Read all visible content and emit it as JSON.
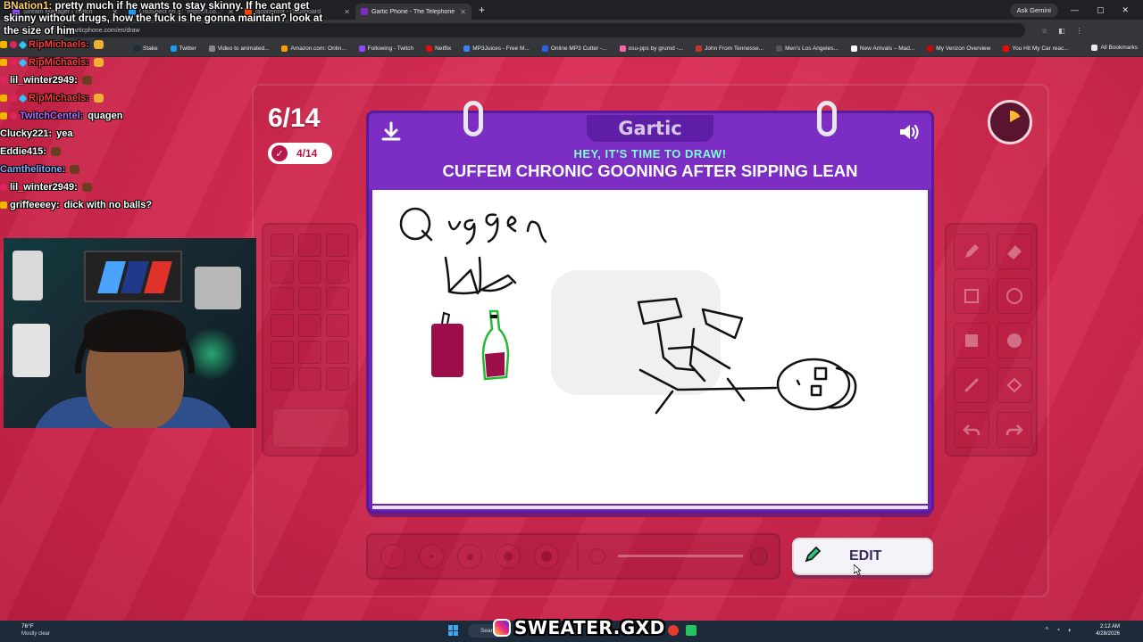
{
  "browser": {
    "tabs": [
      {
        "label": "Stream Manager | Twitch",
        "color": "#9146ff"
      },
      {
        "label": "OsuSpect on X: \"https://t.co...\"",
        "color": "#1d9bf0"
      },
      {
        "label": "djcbrainrot - Dashboard",
        "color": "#ff4500"
      },
      {
        "label": "Gartic Phone - The Telephone G...",
        "color": "#7b2dc4"
      }
    ],
    "ask_gemini": "Ask Gemini",
    "url": "garticphone.com/en/draw",
    "bookmarks": [
      {
        "label": "Stake",
        "color": "#1a2c38"
      },
      {
        "label": "Twitter",
        "color": "#1d9bf0"
      },
      {
        "label": "Video to animated...",
        "color": "#888888"
      },
      {
        "label": "Amazon.com: Onlin...",
        "color": "#ff9900"
      },
      {
        "label": "Following - Twitch",
        "color": "#9146ff"
      },
      {
        "label": "Netflix",
        "color": "#e50914"
      },
      {
        "label": "MP3Juices - Free M...",
        "color": "#3b82f6"
      },
      {
        "label": "Online MP3 Cutter -...",
        "color": "#2563eb"
      },
      {
        "label": "osu-pps by grumd -...",
        "color": "#ff66aa"
      },
      {
        "label": "John From Tennesse...",
        "color": "#c0392b"
      },
      {
        "label": "Men's Los Angeles...",
        "color": "#555555"
      },
      {
        "label": "New Arrivals – Mad...",
        "color": "#ffffff"
      },
      {
        "label": "My Verizon Overview",
        "color": "#cd040b"
      },
      {
        "label": "You Hit My Car reac...",
        "color": "#ff0000"
      }
    ],
    "all_bookmarks": "All Bookmarks"
  },
  "chat": {
    "top_user": "BNation1:",
    "top_message": "pretty much if he wants to stay skinny. If he cant get skinny without drugs, how the fuck is he gonna maintain? look at the size of him",
    "lines": [
      {
        "user": "RipMichaels:",
        "user_color": "#ff3b3b",
        "message": "",
        "badges": [
          "crown",
          "heart",
          "gem"
        ],
        "emote": "#f0b030"
      },
      {
        "user": "RipMichaels:",
        "user_color": "#ff3b3b",
        "message": "",
        "badges": [
          "crown",
          "heart",
          "gem"
        ],
        "emote": "#f0b030"
      },
      {
        "user": "lil_winter2949:",
        "user_color": "#ffffff",
        "message": "",
        "badges": [
          "heart"
        ],
        "emote": "#6b3d20"
      },
      {
        "user": "RipMichaels:",
        "user_color": "#ff3b3b",
        "message": "",
        "badges": [
          "crown",
          "heart",
          "gem"
        ],
        "emote": "#f0b030"
      },
      {
        "user": "TwitchCentel:",
        "user_color": "#b46cff",
        "message": "quagen",
        "badges": [
          "crown",
          "heart"
        ],
        "emote": ""
      },
      {
        "user": "Clucky221:",
        "user_color": "#ffffff",
        "message": "yea",
        "badges": [],
        "emote": ""
      },
      {
        "user": "Eddie415:",
        "user_color": "#ffffff",
        "message": "",
        "badges": [],
        "emote": "#6b3d20"
      },
      {
        "user": "Camthelitone:",
        "user_color": "#8aa8ff",
        "message": "",
        "badges": [],
        "emote": "#6b3d20"
      },
      {
        "user": "lil_winter2949:",
        "user_color": "#ffffff",
        "message": "",
        "badges": [
          "heart"
        ],
        "emote": "#6b3d20"
      },
      {
        "user": "griffeeeey:",
        "user_color": "#ffffff",
        "message": "dick with no balls?",
        "badges": [
          "crown"
        ],
        "emote": ""
      }
    ]
  },
  "game": {
    "round": "6/14",
    "done_count": "4/14",
    "logo": "Gartic",
    "prompt_subtitle": "HEY, IT'S TIME TO DRAW!",
    "prompt": "CUFFEM CHRONIC GOONING AFTER SIPPING LEAN",
    "edit_label": "EDIT",
    "timer_progress": 0.17,
    "tools": [
      "pencil-icon",
      "eraser-icon",
      "rectangle-icon",
      "circle-icon",
      "filled-rectangle-icon",
      "filled-circle-icon",
      "line-icon",
      "fill-bucket-icon",
      "undo-icon",
      "redo-icon"
    ],
    "palette_count": 18,
    "brush_sizes": 5
  },
  "taskbar": {
    "temp": "76°F",
    "weather": "Mostly clear",
    "search": "Search",
    "time": "2:12 AM",
    "date": "4/28/2026"
  },
  "watermark": "SWEATER.GXD"
}
